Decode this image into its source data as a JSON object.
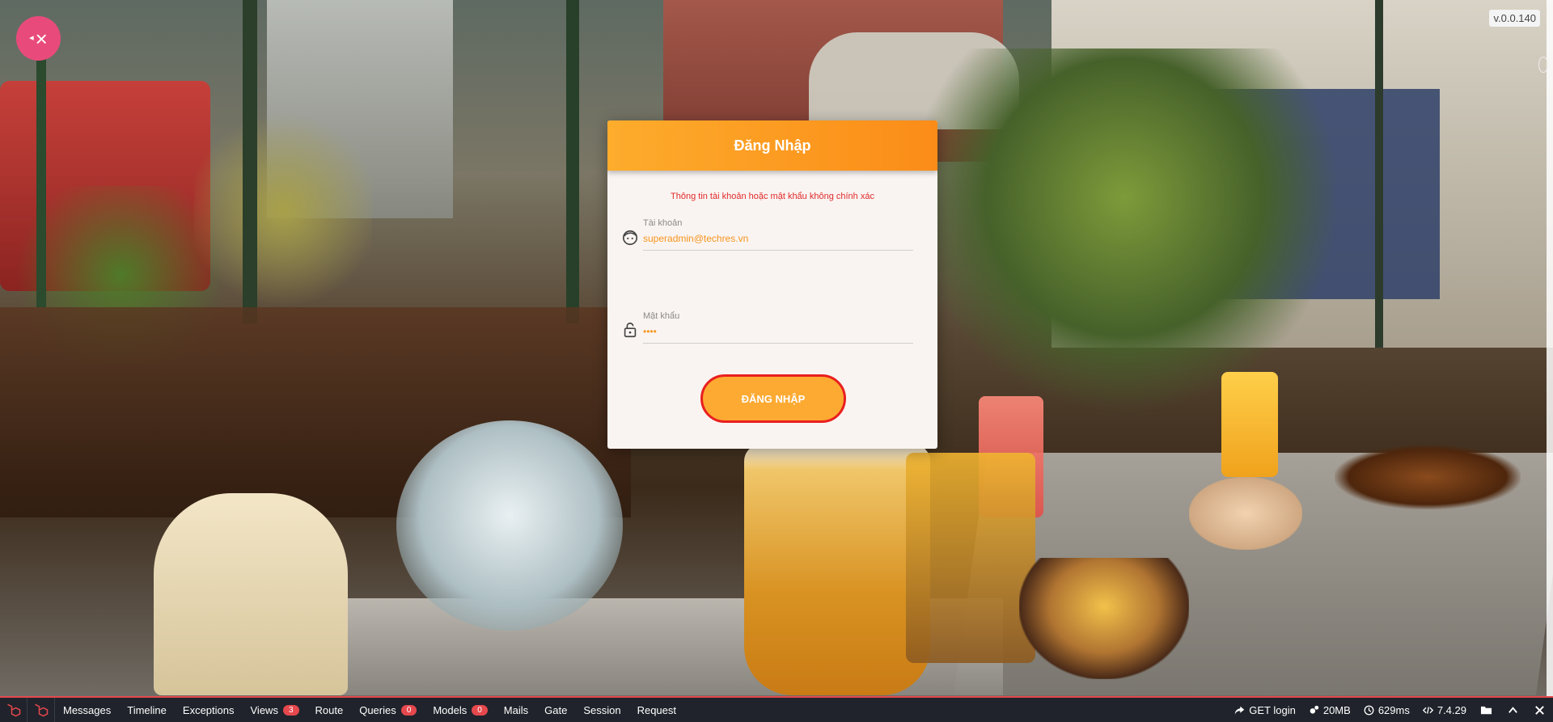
{
  "app": {
    "version": "v.0.0.140"
  },
  "login": {
    "title": "Đăng Nhập",
    "error": "Thông tin tài khoản hoặc mật khẩu không chính xác",
    "username_label": "Tài khoản",
    "username_value": "superadmin@techres.vn",
    "password_label": "Mật khẩu",
    "password_value": "••••",
    "submit_label": "ĐĂNG NHẬP"
  },
  "colors": {
    "header_orange": "#fb8c17",
    "button_orange": "#fcaa32",
    "error_red": "#e22a2a",
    "debugbar_bg": "#20232b",
    "accent_pink": "#e84b7b"
  },
  "debugbar": {
    "tabs": [
      {
        "label": "Messages"
      },
      {
        "label": "Timeline"
      },
      {
        "label": "Exceptions"
      },
      {
        "label": "Views",
        "count": "3"
      },
      {
        "label": "Route"
      },
      {
        "label": "Queries",
        "count": "0"
      },
      {
        "label": "Models",
        "count": "0"
      },
      {
        "label": "Mails"
      },
      {
        "label": "Gate"
      },
      {
        "label": "Session"
      },
      {
        "label": "Request"
      }
    ],
    "request": "GET login",
    "memory": "20MB",
    "time": "629ms",
    "php": "7.4.29"
  }
}
